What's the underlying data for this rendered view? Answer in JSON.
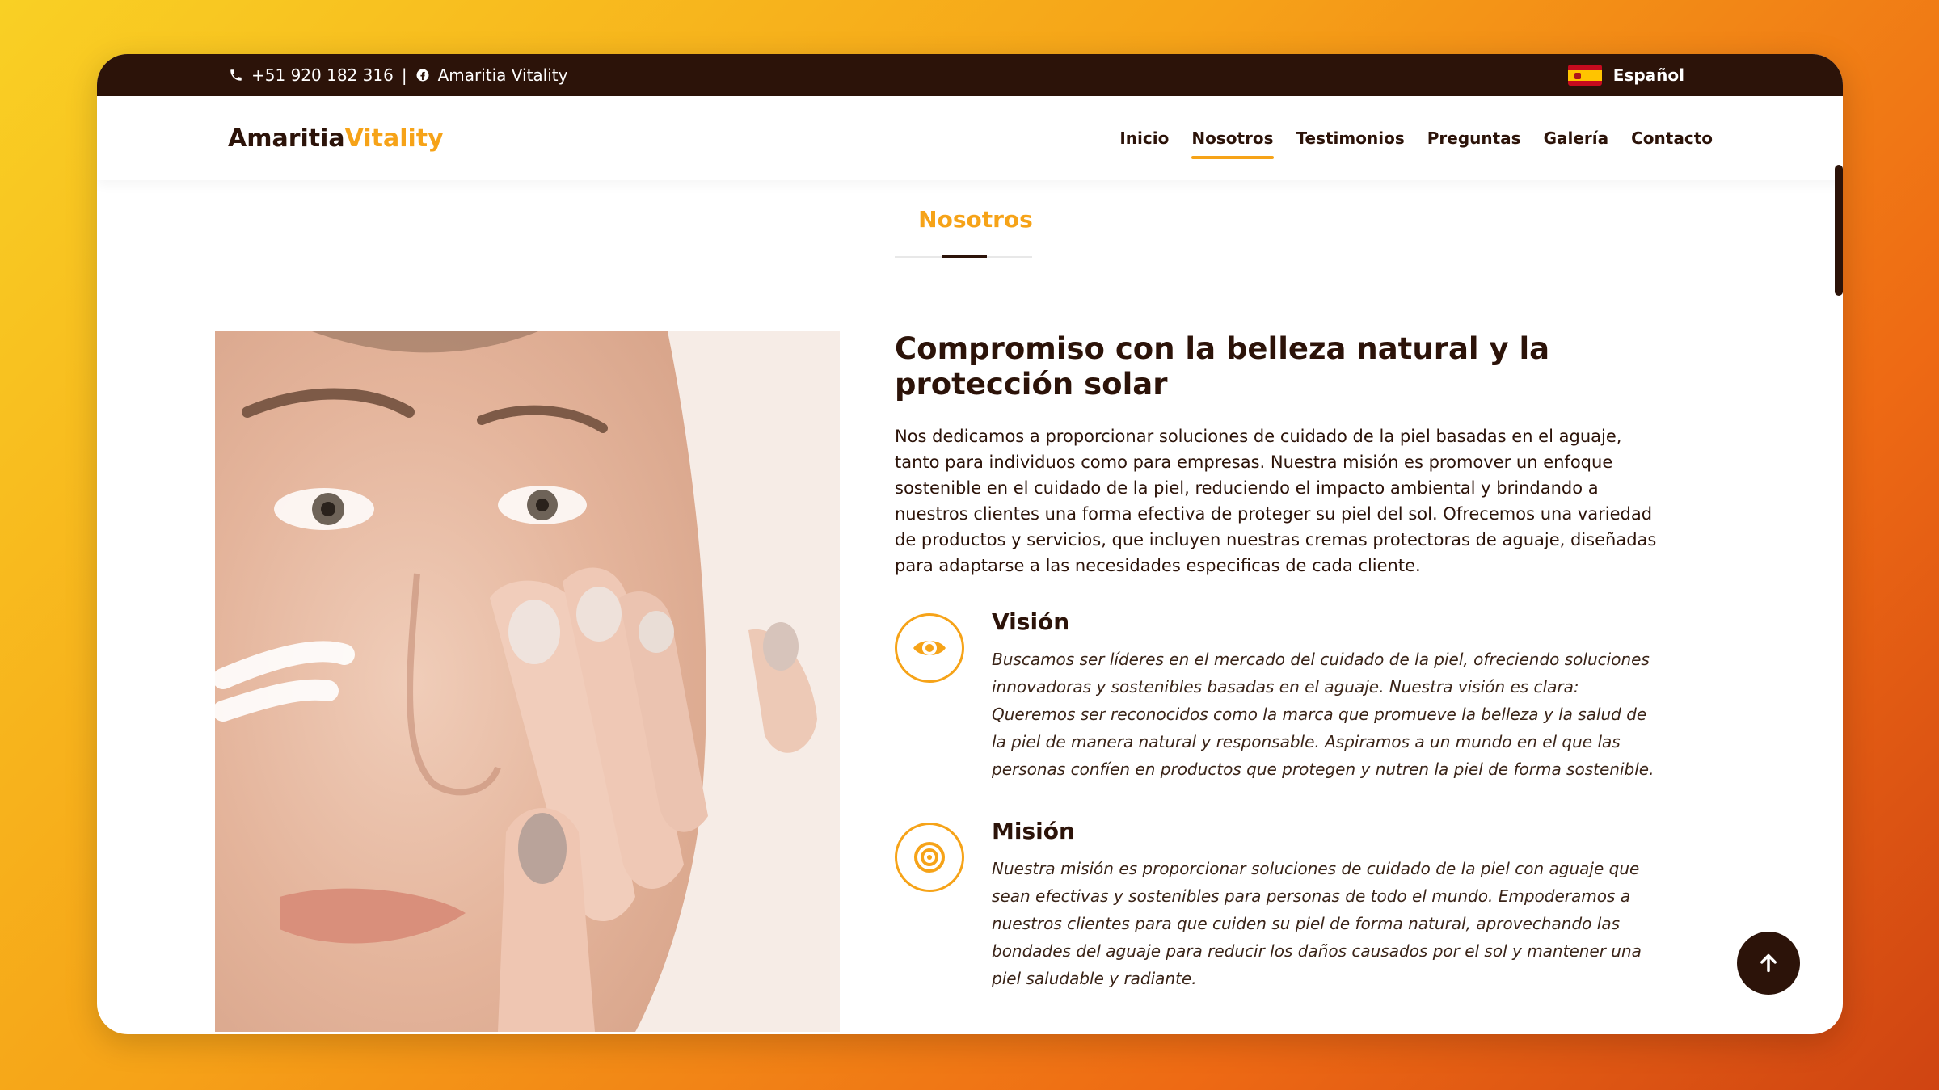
{
  "topbar": {
    "phone": "+51 920 182 316",
    "separator": "|",
    "social": "Amaritia Vitality",
    "language": "Español"
  },
  "nav": {
    "logo_main": "Amaritia",
    "logo_accent": "Vitality",
    "items": [
      "Inicio",
      "Nosotros",
      "Testimonios",
      "Preguntas",
      "Galería",
      "Contacto"
    ],
    "active": "Nosotros"
  },
  "section": {
    "title": "Nosotros"
  },
  "about": {
    "heading": "Compromiso con la belleza natural y la protección solar",
    "intro": "Nos dedicamos a proporcionar soluciones de cuidado de la piel basadas en el aguaje, tanto para individuos como para empresas. Nuestra misión es promover un enfoque sostenible en el cuidado de la piel, reduciendo el impacto ambiental y brindando a nuestros clientes una forma efectiva de proteger su piel del sol. Ofrecemos una variedad de productos y servicios, que incluyen nuestras cremas protectoras de aguaje, diseñadas para adaptarse a las necesidades especificas de cada cliente."
  },
  "features": [
    {
      "title": "Visión",
      "icon": "eye-icon",
      "text": "Buscamos ser líderes en el mercado del cuidado de la piel, ofreciendo soluciones innovadoras y sostenibles basadas en el aguaje. Nuestra visión es clara: Queremos ser reconocidos como la marca que promueve la belleza y la salud de la piel de manera natural y responsable. Aspiramos a un mundo en el que las personas confíen en productos que protegen y nutren la piel de forma sostenible."
    },
    {
      "title": "Misión",
      "icon": "target-icon",
      "text": "Nuestra misión es proporcionar soluciones de cuidado de la piel con aguaje que sean efectivas y sostenibles para personas de todo el mundo. Empoderamos a nuestros clientes para que cuiden su piel de forma natural, aprovechando las bondades del aguaje para reducir los daños causados por el sol y mantener una piel saludable y radiante."
    }
  ],
  "colors": {
    "brand_dark": "#2c1309",
    "accent": "#f6a318"
  }
}
